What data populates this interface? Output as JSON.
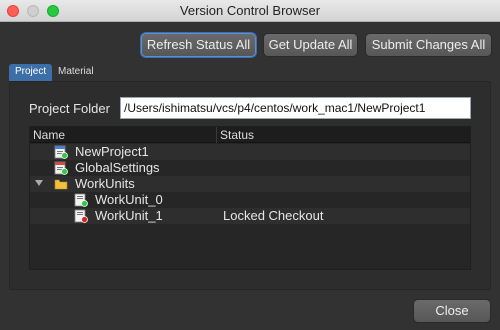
{
  "window": {
    "title": "Version Control Browser"
  },
  "toolbar": {
    "refresh_label": "Refresh Status All",
    "update_label": "Get Update All",
    "submit_label": "Submit Changes All"
  },
  "tabs": [
    {
      "label": "Project",
      "active": true
    },
    {
      "label": "Material",
      "active": false
    }
  ],
  "project_folder": {
    "label": "Project Folder",
    "value": "/Users/ishimatsu/vcs/p4/centos/work_mac1/NewProject1"
  },
  "tree": {
    "columns": {
      "name": "Name",
      "status": "Status"
    },
    "rows": [
      {
        "name": "NewProject1",
        "status": "",
        "icon": "project-file-icon",
        "badge": "green"
      },
      {
        "name": "GlobalSettings",
        "status": "",
        "icon": "settings-file-icon",
        "badge": "green"
      },
      {
        "name": "WorkUnits",
        "status": "",
        "icon": "folder-icon",
        "expanded": true
      },
      {
        "name": "WorkUnit_0",
        "status": "",
        "icon": "workunit-file-icon",
        "badge": "green"
      },
      {
        "name": "WorkUnit_1",
        "status": "Locked Checkout",
        "icon": "workunit-file-icon",
        "badge": "red"
      }
    ]
  },
  "footer": {
    "close_label": "Close"
  },
  "colors": {
    "accent": "#3c6ea8",
    "badge_ok": "#2ecc40",
    "badge_locked": "#e02020"
  }
}
